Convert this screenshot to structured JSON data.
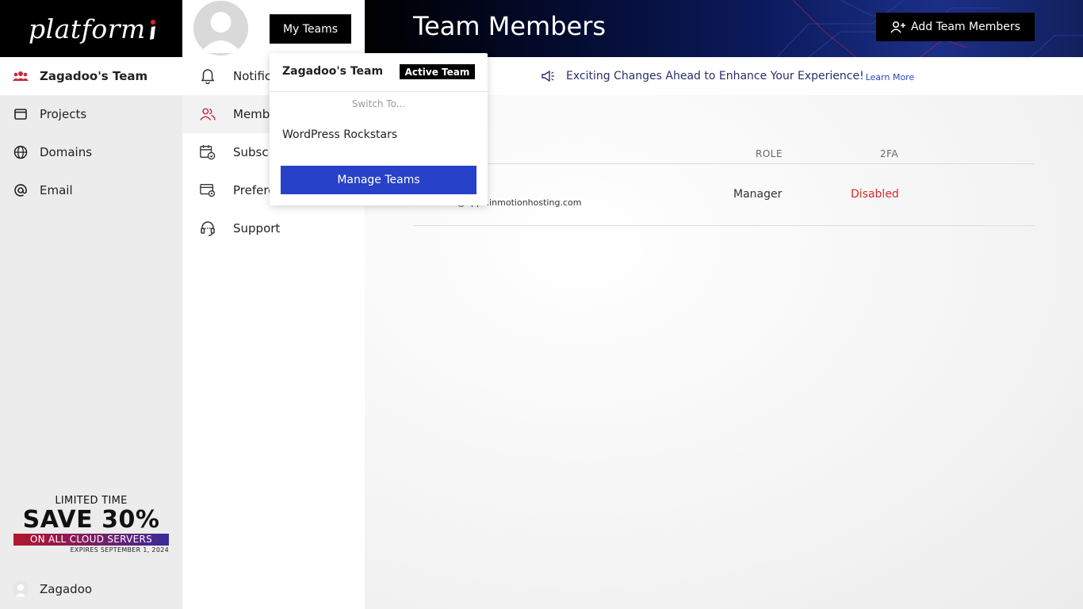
{
  "brand": {
    "logo_text": "platform",
    "accent": "#e02030"
  },
  "sidebar": {
    "items": [
      {
        "label": "Zagadoo's Team",
        "icon": "team-icon",
        "active": true
      },
      {
        "label": "Projects",
        "icon": "window-icon"
      },
      {
        "label": "Domains",
        "icon": "globe-icon"
      },
      {
        "label": "Email",
        "icon": "at-icon"
      }
    ],
    "promo": {
      "line1": "LIMITED TIME",
      "line2": "SAVE 30%",
      "line3": "ON ALL CLOUD SERVERS",
      "line4": "EXPIRES SEPTEMBER 1, 2024"
    },
    "user": {
      "name": "Zagadoo"
    }
  },
  "subnav": {
    "my_teams_label": "My Teams",
    "items": [
      {
        "label": "Notifications",
        "icon": "bell-icon"
      },
      {
        "label": "Members",
        "icon": "members-icon",
        "active": true
      },
      {
        "label": "Subscriptions",
        "icon": "calendar-refresh-icon"
      },
      {
        "label": "Preferences",
        "icon": "card-gear-icon"
      },
      {
        "label": "Support",
        "icon": "headset-icon"
      }
    ]
  },
  "header": {
    "title": "Team Members",
    "add_button_label": "Add Team Members"
  },
  "notice": {
    "text": "Exciting Changes Ahead to Enhance Your Experience!",
    "link": "Learn More"
  },
  "table": {
    "columns": {
      "role": "ROLE",
      "twofa": "2FA"
    },
    "rows": [
      {
        "email": "demo@apps.inmotionhosting.com",
        "role": "Manager",
        "twofa": "Disabled"
      }
    ]
  },
  "dropdown": {
    "current_team": "Zagadoo's Team",
    "active_badge": "Active Team",
    "switch_label": "Switch To...",
    "options": [
      "WordPress Rockstars"
    ],
    "manage_label": "Manage Teams"
  },
  "colors": {
    "primary_blue": "#2741c8",
    "danger": "#d42a2a",
    "icon_red": "#c8283c"
  }
}
